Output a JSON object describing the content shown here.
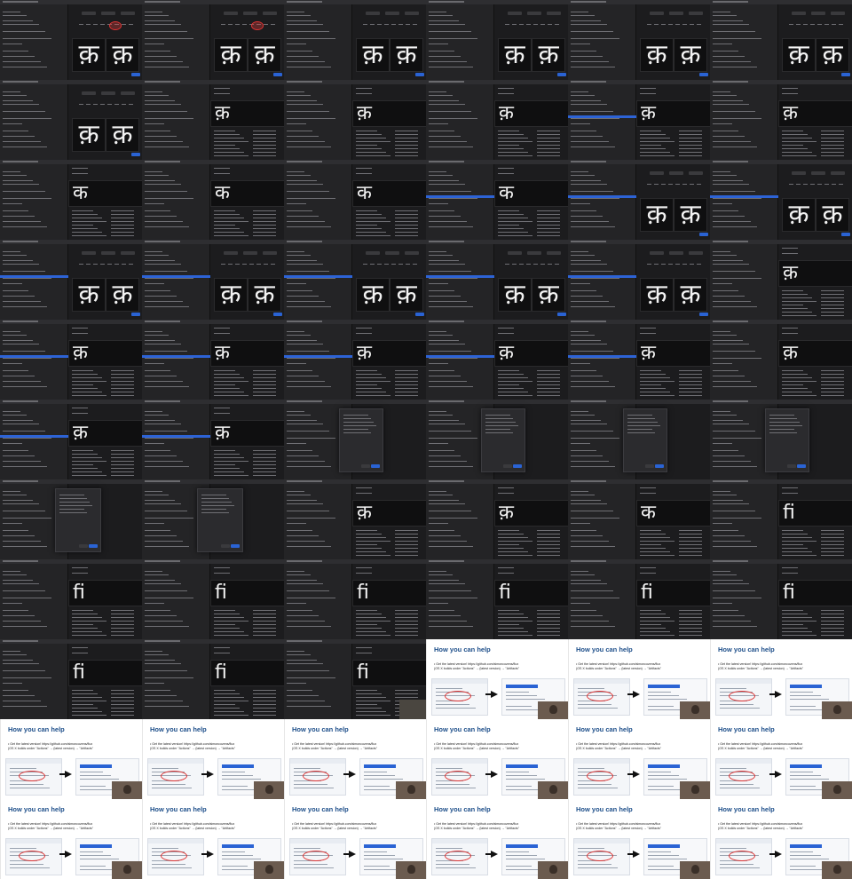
{
  "grid": {
    "columns": 6,
    "rows": 11
  },
  "app_tiles": [
    {
      "glyphs": [
        "क़",
        "क़"
      ],
      "variant": "compare",
      "marker": true
    },
    {
      "glyphs": [
        "क़",
        "क़"
      ],
      "variant": "compare",
      "marker": true
    },
    {
      "glyphs": [
        "क़",
        "क़"
      ],
      "variant": "compare"
    },
    {
      "glyphs": [
        "क़",
        "क़"
      ],
      "variant": "compare"
    },
    {
      "glyphs": [
        "क़",
        "क़"
      ],
      "variant": "compare"
    },
    {
      "glyphs": [
        "क़",
        "क़"
      ],
      "variant": "compare"
    },
    {
      "glyphs": [
        "क़",
        "क़"
      ],
      "variant": "compare"
    },
    {
      "glyphs": [
        "क़"
      ],
      "variant": "single"
    },
    {
      "glyphs": [
        "क़"
      ],
      "variant": "single"
    },
    {
      "glyphs": [
        "क़"
      ],
      "variant": "single"
    },
    {
      "glyphs": [
        "क़"
      ],
      "variant": "single",
      "sel": true
    },
    {
      "glyphs": [
        "क़"
      ],
      "variant": "single"
    },
    {
      "glyphs": [
        "क"
      ],
      "variant": "single"
    },
    {
      "glyphs": [
        "क"
      ],
      "variant": "single"
    },
    {
      "glyphs": [
        "क"
      ],
      "variant": "single"
    },
    {
      "glyphs": [
        "क"
      ],
      "variant": "single",
      "sel": true
    },
    {
      "glyphs": [
        "क़",
        "क़"
      ],
      "variant": "compare",
      "sel": true
    },
    {
      "glyphs": [
        "क़",
        "क़"
      ],
      "variant": "compare",
      "sel": true
    },
    {
      "glyphs": [
        "क़",
        "क़"
      ],
      "variant": "compare",
      "sel": true
    },
    {
      "glyphs": [
        "क़",
        "क़"
      ],
      "variant": "compare",
      "sel": true
    },
    {
      "glyphs": [
        "क़",
        "क़"
      ],
      "variant": "compare",
      "sel": true
    },
    {
      "glyphs": [
        "क़",
        "क़"
      ],
      "variant": "compare",
      "sel": true
    },
    {
      "glyphs": [
        "क़",
        "क़"
      ],
      "variant": "compare",
      "sel": true
    },
    {
      "glyphs": [
        "क़"
      ],
      "variant": "single"
    },
    {
      "glyphs": [
        "क़"
      ],
      "variant": "single",
      "sel": true
    },
    {
      "glyphs": [
        "क़"
      ],
      "variant": "single",
      "sel": true
    },
    {
      "glyphs": [
        "क़"
      ],
      "variant": "single",
      "sel": true
    },
    {
      "glyphs": [
        "क़"
      ],
      "variant": "single",
      "sel": true
    },
    {
      "glyphs": [
        "क़"
      ],
      "variant": "single",
      "sel": true
    },
    {
      "glyphs": [
        "क़"
      ],
      "variant": "single"
    },
    {
      "glyphs": [
        "क़"
      ],
      "variant": "single",
      "sel": true
    },
    {
      "glyphs": [
        "क़"
      ],
      "variant": "single",
      "sel": true
    },
    {
      "glyphs": [],
      "variant": "dialog"
    },
    {
      "glyphs": [],
      "variant": "dialog"
    },
    {
      "glyphs": [],
      "variant": "dialog"
    },
    {
      "glyphs": [],
      "variant": "dialog"
    },
    {
      "glyphs": [],
      "variant": "dialog2"
    },
    {
      "glyphs": [],
      "variant": "dialog2"
    },
    {
      "glyphs": [
        "क़"
      ],
      "variant": "single"
    },
    {
      "glyphs": [
        "क़"
      ],
      "variant": "single"
    },
    {
      "glyphs": [
        "क"
      ],
      "variant": "single"
    },
    {
      "glyphs": [
        "ﬁ"
      ],
      "variant": "single"
    },
    {
      "glyphs": [
        "ﬁ"
      ],
      "variant": "single"
    },
    {
      "glyphs": [
        "ﬁ"
      ],
      "variant": "single"
    },
    {
      "glyphs": [
        "ﬁ"
      ],
      "variant": "single"
    },
    {
      "glyphs": [
        "ﬁ"
      ],
      "variant": "single"
    },
    {
      "glyphs": [
        "ﬁ"
      ],
      "variant": "single"
    },
    {
      "glyphs": [
        "ﬁ"
      ],
      "variant": "single"
    },
    {
      "glyphs": [
        "ﬁ"
      ],
      "variant": "single"
    },
    {
      "glyphs": [
        "ﬁ"
      ],
      "variant": "single"
    },
    {
      "glyphs": [
        "ﬁ"
      ],
      "variant": "single",
      "cam": true
    }
  ],
  "slide": {
    "title": "How you can help",
    "bullet": "Get the latest version! https://github.com/simoncozens/flux",
    "bullet_sub": "(OS X builds under \"Actions\" → (latest version) → \"Artifacts\"",
    "count": 15
  }
}
